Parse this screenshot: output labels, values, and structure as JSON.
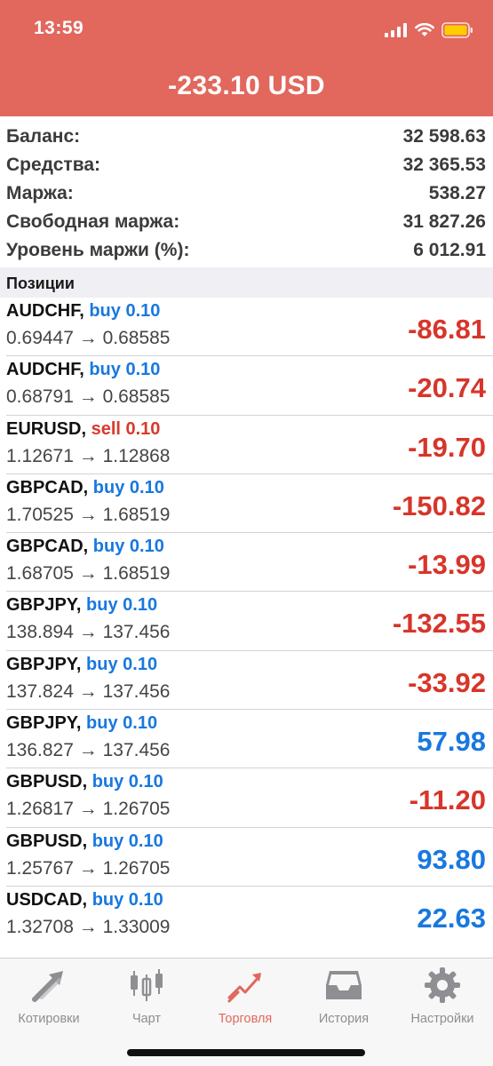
{
  "status_bar": {
    "time": "13:59"
  },
  "header": {
    "total": "-233.10 USD",
    "color": "#e2675d"
  },
  "summary": [
    {
      "label": "Баланс:",
      "value": "32 598.63"
    },
    {
      "label": "Средства:",
      "value": "32 365.53"
    },
    {
      "label": "Маржа:",
      "value": "538.27"
    },
    {
      "label": "Свободная маржа:",
      "value": "31 827.26"
    },
    {
      "label": "Уровень маржи (%):",
      "value": "6 012.91"
    }
  ],
  "positions_header": "Позиции",
  "positions": [
    {
      "symbol": "AUDCHF,",
      "side": "buy 0.10",
      "prices": "0.69447 → 0.68585",
      "profit": "-86.81"
    },
    {
      "symbol": "AUDCHF,",
      "side": "buy 0.10",
      "prices": "0.68791 → 0.68585",
      "profit": "-20.74"
    },
    {
      "symbol": "EURUSD,",
      "side": "sell 0.10",
      "prices": "1.12671 → 1.12868",
      "profit": "-19.70"
    },
    {
      "symbol": "GBPCAD,",
      "side": "buy 0.10",
      "prices": "1.70525 → 1.68519",
      "profit": "-150.82"
    },
    {
      "symbol": "GBPCAD,",
      "side": "buy 0.10",
      "prices": "1.68705 → 1.68519",
      "profit": "-13.99"
    },
    {
      "symbol": "GBPJPY,",
      "side": "buy 0.10",
      "prices": "138.894 → 137.456",
      "profit": "-132.55"
    },
    {
      "symbol": "GBPJPY,",
      "side": "buy 0.10",
      "prices": "137.824 → 137.456",
      "profit": "-33.92"
    },
    {
      "symbol": "GBPJPY,",
      "side": "buy 0.10",
      "prices": "136.827 → 137.456",
      "profit": "57.98"
    },
    {
      "symbol": "GBPUSD,",
      "side": "buy 0.10",
      "prices": "1.26817 → 1.26705",
      "profit": "-11.20"
    },
    {
      "symbol": "GBPUSD,",
      "side": "buy 0.10",
      "prices": "1.25767 → 1.26705",
      "profit": "93.80"
    },
    {
      "symbol": "USDCAD,",
      "side": "buy 0.10",
      "prices": "1.32708 → 1.33009",
      "profit": "22.63"
    }
  ],
  "tabs": [
    {
      "label": "Котировки",
      "icon": "quotes-arrows-icon"
    },
    {
      "label": "Чарт",
      "icon": "candlestick-chart-icon"
    },
    {
      "label": "Торговля",
      "icon": "trade-trend-icon",
      "active": true
    },
    {
      "label": "История",
      "icon": "history-tray-icon"
    },
    {
      "label": "Настройки",
      "icon": "settings-gear-icon"
    }
  ],
  "colors": {
    "accent": "#e2675d",
    "buy": "#1878df",
    "sell": "#d73a2d",
    "loss": "#d7352a",
    "gain": "#1878df"
  }
}
